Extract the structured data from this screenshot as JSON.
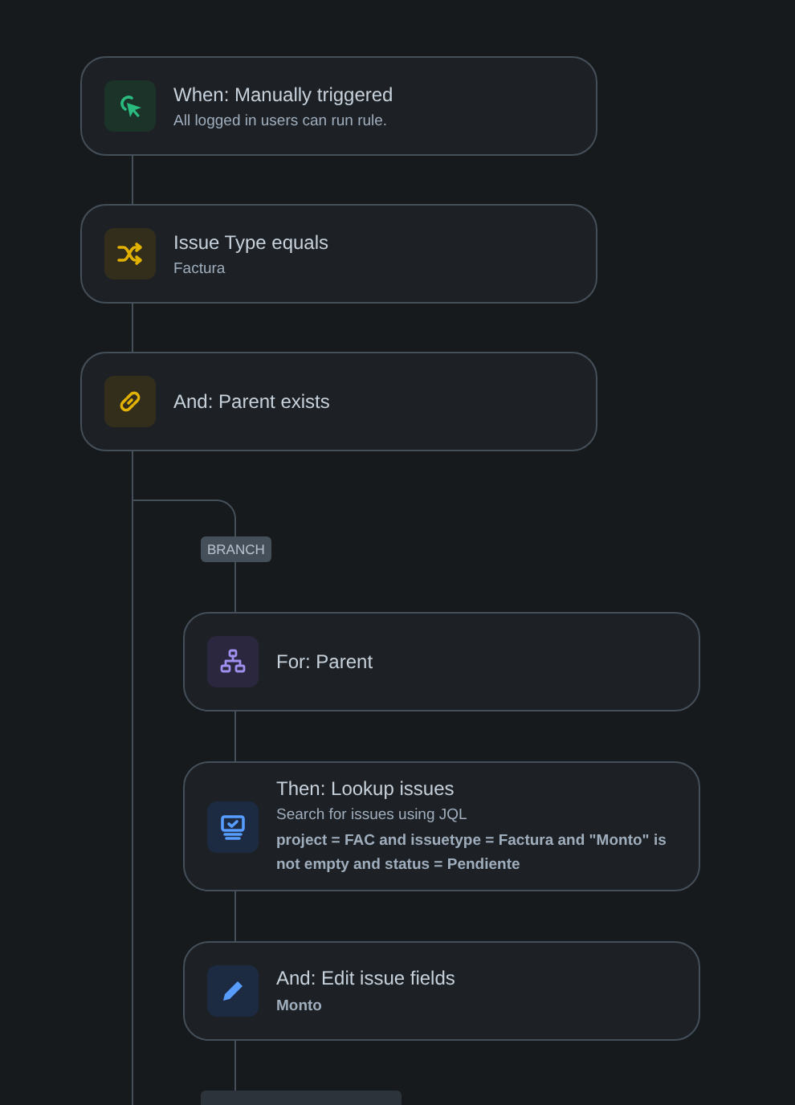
{
  "steps": [
    {
      "kind": "trigger",
      "title": "When: Manually triggered",
      "description": "All logged in users can run rule."
    },
    {
      "kind": "typecheck",
      "title": "Issue Type equals",
      "description": "Factura"
    },
    {
      "kind": "relation",
      "title": "And: Parent exists"
    }
  ],
  "branch": {
    "label": "BRANCH",
    "steps": [
      {
        "kind": "branch",
        "title": "For: Parent"
      },
      {
        "kind": "lookup",
        "title": "Then: Lookup issues",
        "description": "Search for issues using JQL",
        "detail": "project = FAC and issuetype = Factura and \"Monto\" is not empty and status = Pendiente"
      },
      {
        "kind": "edit",
        "title": "And: Edit issue fields",
        "detail": "Monto"
      }
    ]
  }
}
